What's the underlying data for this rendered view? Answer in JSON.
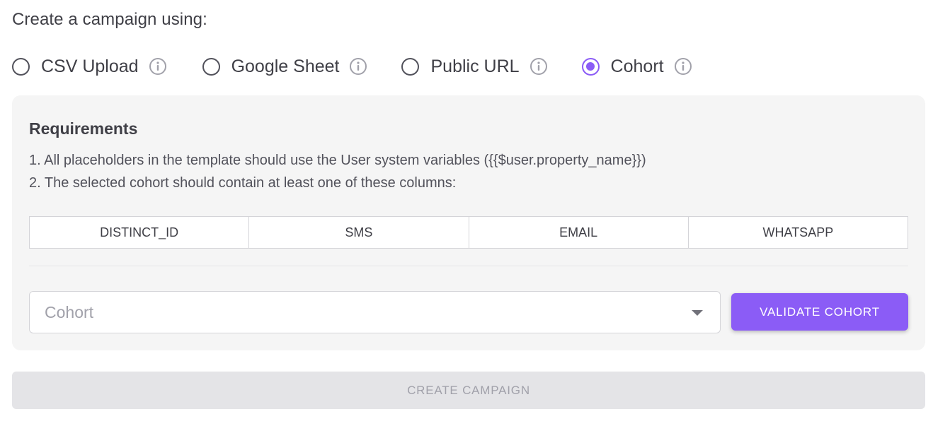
{
  "heading": "Create a campaign using:",
  "source_options": [
    {
      "label": "CSV Upload",
      "checked": false,
      "icon": "info-icon"
    },
    {
      "label": "Google Sheet",
      "checked": false,
      "icon": "info-icon"
    },
    {
      "label": "Public URL",
      "checked": false,
      "icon": "info-icon"
    },
    {
      "label": "Cohort",
      "checked": true,
      "icon": "info-icon"
    }
  ],
  "requirements": {
    "title": "Requirements",
    "line1": "1. All placeholders in the template should use the User system variables ({{$user.property_name}})",
    "line2": "2. The selected cohort should contain at least one of these columns:",
    "columns": [
      "DISTINCT_ID",
      "SMS",
      "EMAIL",
      "WHATSAPP"
    ]
  },
  "cohort_select": {
    "placeholder": "Cohort",
    "icon": "caret-down-icon"
  },
  "validate_button": "VALIDATE COHORT",
  "create_button": "CREATE CAMPAIGN",
  "colors": {
    "accent": "#8b5cf6",
    "panel_bg": "#f5f5f5",
    "disabled_bg": "#e4e4e7",
    "disabled_text": "#a1a1aa"
  }
}
